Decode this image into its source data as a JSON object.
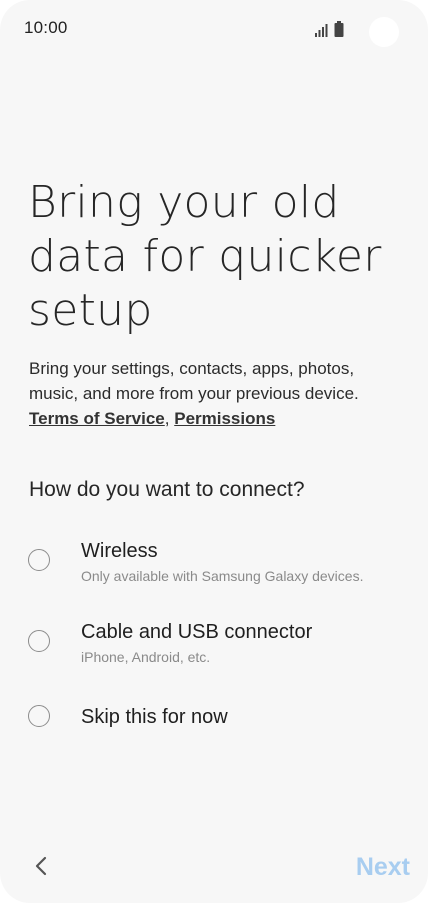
{
  "status_bar": {
    "time": "10:00",
    "icons": [
      "signal-icon",
      "battery-icon"
    ]
  },
  "header": {
    "title": "Bring your old data for quicker setup",
    "description": "Bring your settings, contacts, apps, photos, music, and more from your previous device.",
    "terms_link": "Terms of Service",
    "separator": ",",
    "permissions_link": "Permissions"
  },
  "question": "How do you want to connect?",
  "options": [
    {
      "title": "Wireless",
      "subtitle": "Only available with Samsung Galaxy devices.",
      "selected": false
    },
    {
      "title": "Cable and USB connector",
      "subtitle": "iPhone, Android, etc.",
      "selected": false
    },
    {
      "title": "Skip this for now",
      "subtitle": "",
      "selected": false
    }
  ],
  "navigation": {
    "back_icon": "chevron-left-icon",
    "next_label": "Next",
    "next_enabled": false
  },
  "colors": {
    "background": "#f7f7f7",
    "next_disabled": "#a8cdf0",
    "radio_border": "#8c8c8c",
    "subtitle": "#8a8a8a"
  }
}
